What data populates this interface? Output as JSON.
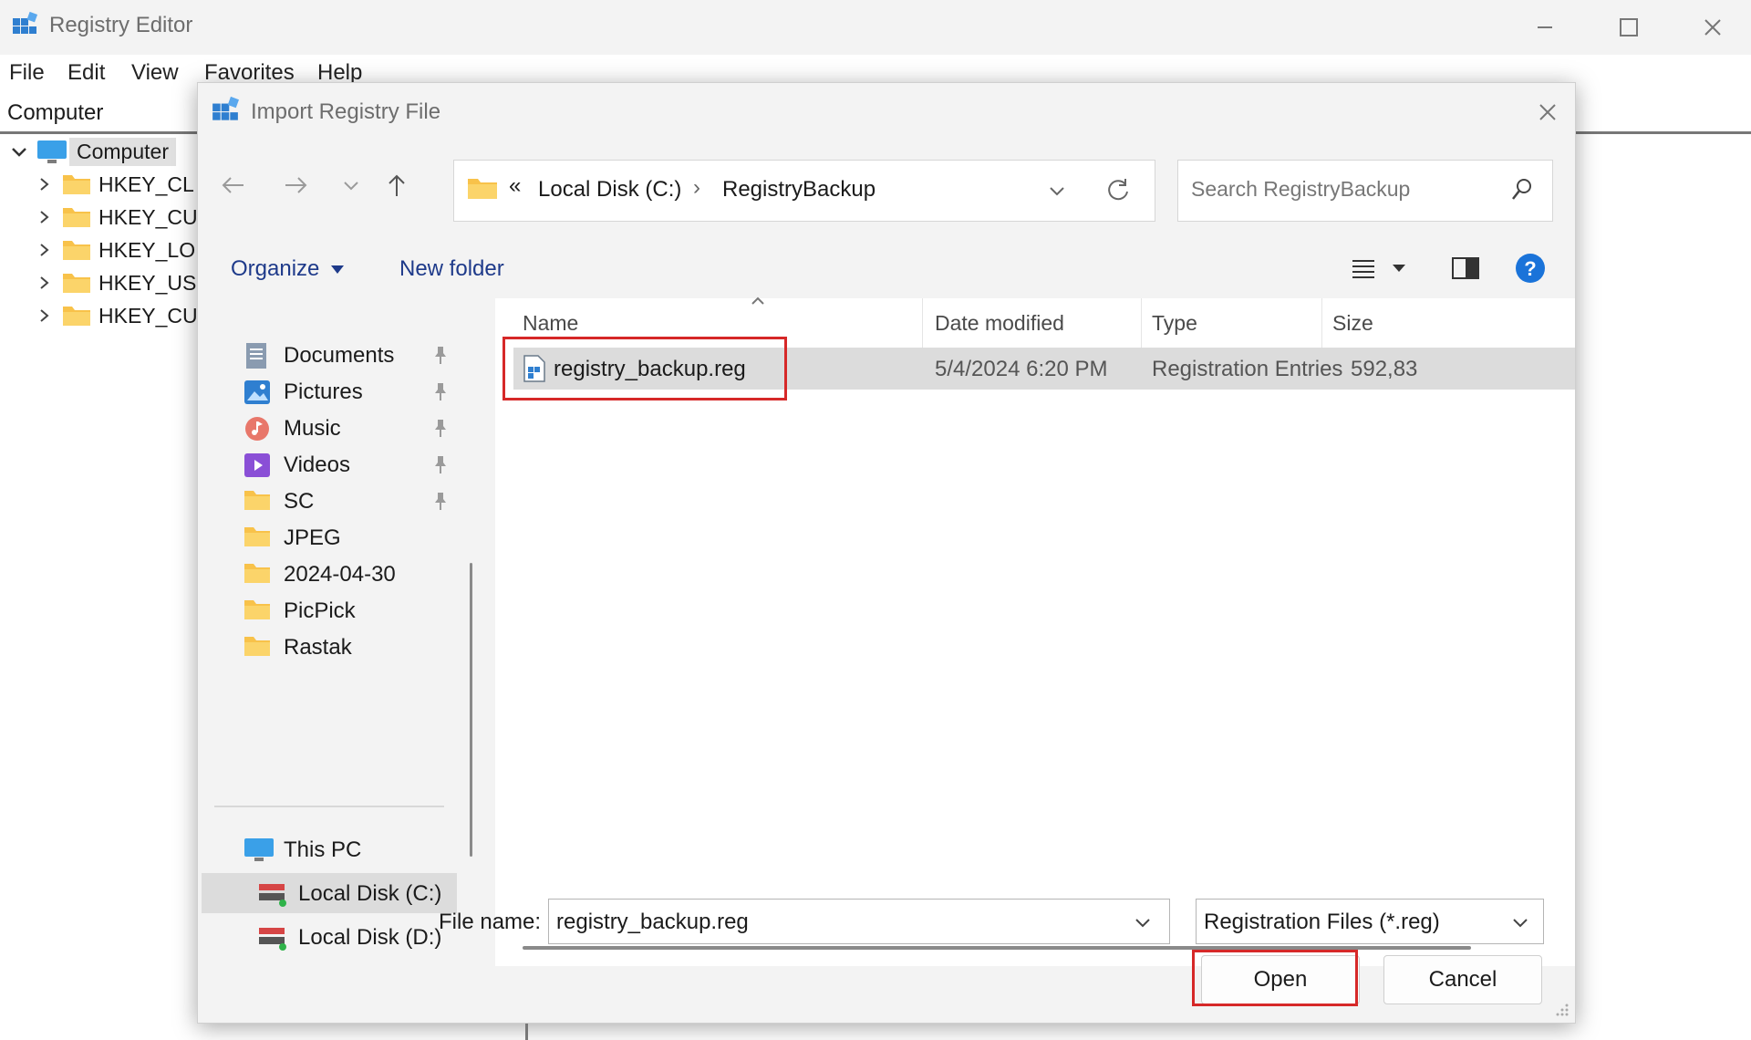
{
  "app": {
    "title": "Registry Editor",
    "menu": [
      "File",
      "Edit",
      "View",
      "Favorites",
      "Help"
    ],
    "address": "Computer",
    "tree": {
      "root": "Computer",
      "children": [
        "HKEY_CL",
        "HKEY_CU",
        "HKEY_LO",
        "HKEY_USI",
        "HKEY_CU"
      ]
    }
  },
  "dialog": {
    "title": "Import Registry File",
    "breadcrumb": {
      "overflow": "«",
      "items": [
        "Local Disk (C:)",
        "RegistryBackup"
      ],
      "separator": "›"
    },
    "search_placeholder": "Search RegistryBackup",
    "commands": {
      "organize": "Organize",
      "new_folder": "New folder"
    },
    "nav": {
      "quick": [
        {
          "label": "Documents",
          "icon": "documents-icon",
          "pinned": true
        },
        {
          "label": "Pictures",
          "icon": "pictures-icon",
          "pinned": true
        },
        {
          "label": "Music",
          "icon": "music-icon",
          "pinned": true
        },
        {
          "label": "Videos",
          "icon": "videos-icon",
          "pinned": true
        },
        {
          "label": "SC",
          "icon": "folder-icon",
          "pinned": true
        },
        {
          "label": "JPEG",
          "icon": "folder-icon",
          "pinned": false
        },
        {
          "label": "2024-04-30",
          "icon": "folder-icon",
          "pinned": false
        },
        {
          "label": "PicPick",
          "icon": "folder-icon",
          "pinned": false
        },
        {
          "label": "Rastak",
          "icon": "folder-icon",
          "pinned": false
        }
      ],
      "this_pc": "This PC",
      "drives": [
        "Local Disk (C:)",
        "Local Disk (D:)"
      ]
    },
    "columns": [
      "Name",
      "Date modified",
      "Type",
      "Size"
    ],
    "files": [
      {
        "name": "registry_backup.reg",
        "date": "5/4/2024 6:20 PM",
        "type": "Registration Entries",
        "size": "592,83"
      }
    ],
    "file_name_label": "File name:",
    "file_name_value": "registry_backup.reg",
    "file_type": "Registration Files (*.reg)",
    "open_label": "Open",
    "cancel_label": "Cancel"
  },
  "colors": {
    "highlight": "#d62828",
    "folder": "#f8c24a",
    "accent": "#0067c0"
  }
}
